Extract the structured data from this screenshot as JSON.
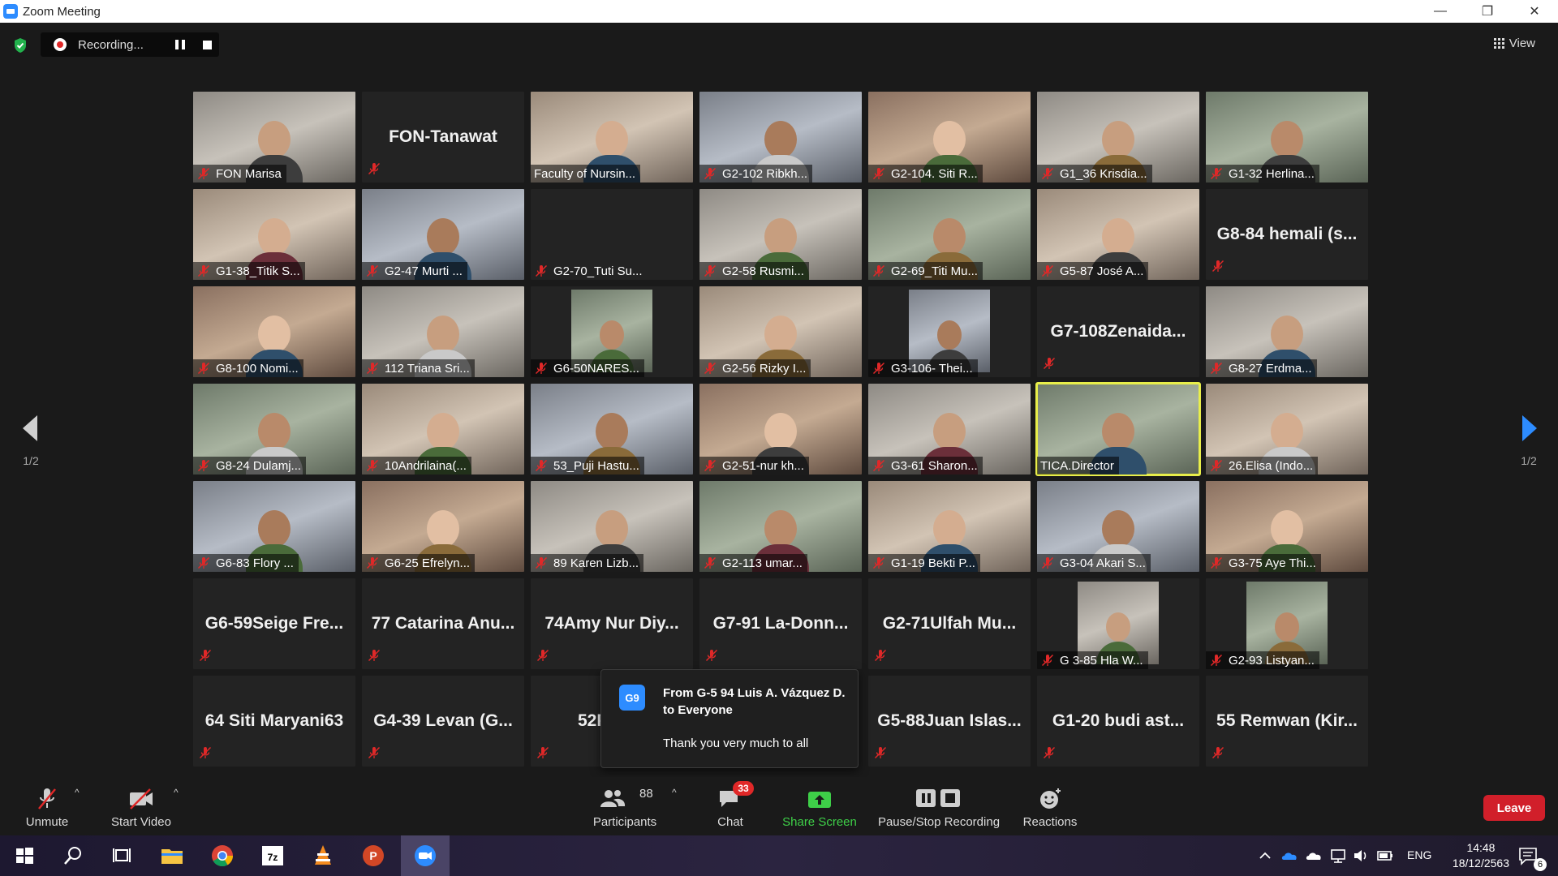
{
  "window": {
    "title": "Zoom Meeting",
    "controls": [
      "—",
      "❐",
      "✕"
    ]
  },
  "recording": {
    "status_text": "Recording...",
    "pause_label": "",
    "stop_label": ""
  },
  "view_button": {
    "label": "View"
  },
  "pagination": {
    "left": "1/2",
    "right": "1/2"
  },
  "participants": [
    {
      "name": "FON Marisa",
      "video": true,
      "muted": true
    },
    {
      "name": "FON-Tanawat",
      "video": false,
      "muted": true
    },
    {
      "name": "Faculty of Nursin...",
      "video": true,
      "muted": false
    },
    {
      "name": "G2-102 Ribkh...",
      "video": true,
      "muted": true
    },
    {
      "name": "G2-104. Siti R...",
      "video": true,
      "muted": true
    },
    {
      "name": "G1_36 Krisdia...",
      "video": true,
      "muted": true
    },
    {
      "name": "G1-32 Herlina...",
      "video": true,
      "muted": true
    },
    {
      "name": "G1-38_Titik S...",
      "video": true,
      "muted": true
    },
    {
      "name": "G2-47 Murti ...",
      "video": true,
      "muted": true
    },
    {
      "name": "G2-70_Tuti Su...",
      "video": true,
      "muted": true,
      "dark": true
    },
    {
      "name": "G2-58 Rusmi...",
      "video": true,
      "muted": true
    },
    {
      "name": "G2-69_Titi Mu...",
      "video": true,
      "muted": true
    },
    {
      "name": "G5-87 José A...",
      "video": true,
      "muted": true
    },
    {
      "name": "G8-84 hemali (s...",
      "video": false,
      "muted": true
    },
    {
      "name": "G8-100 Nomi...",
      "video": true,
      "muted": true
    },
    {
      "name": "112 Triana Sri...",
      "video": true,
      "muted": true
    },
    {
      "name": "G6-50NARES...",
      "video": true,
      "muted": true,
      "thumb": true
    },
    {
      "name": "G2-56 Rizky I...",
      "video": true,
      "muted": true
    },
    {
      "name": "G3-106- Thei...",
      "video": true,
      "muted": true,
      "thumb": true
    },
    {
      "name": "G7-108Zenaida...",
      "video": false,
      "muted": true
    },
    {
      "name": "G8-27 Erdma...",
      "video": true,
      "muted": true
    },
    {
      "name": "G8-24 Dulamj...",
      "video": true,
      "muted": true
    },
    {
      "name": "10Andrilaina(...",
      "video": true,
      "muted": true
    },
    {
      "name": "53_Puji Hastu...",
      "video": true,
      "muted": true
    },
    {
      "name": "G2-51-nur kh...",
      "video": true,
      "muted": true
    },
    {
      "name": "G3-61 Sharon...",
      "video": true,
      "muted": true
    },
    {
      "name": "TICA.Director",
      "video": true,
      "muted": false,
      "active": true
    },
    {
      "name": "26.Elisa (Indo...",
      "video": true,
      "muted": true
    },
    {
      "name": "G6-83 Flory ...",
      "video": true,
      "muted": true
    },
    {
      "name": "G6-25 Efrelyn...",
      "video": true,
      "muted": true
    },
    {
      "name": "89 Karen Lizb...",
      "video": true,
      "muted": true
    },
    {
      "name": "G2-113 umar...",
      "video": true,
      "muted": true
    },
    {
      "name": "G1-19 Bekti P...",
      "video": true,
      "muted": true
    },
    {
      "name": "G3-04 Akari S...",
      "video": true,
      "muted": true
    },
    {
      "name": "G3-75 Aye Thi...",
      "video": true,
      "muted": true
    },
    {
      "name": "G6-59Seige Fre...",
      "video": false,
      "muted": true
    },
    {
      "name": "77 Catarina Anu...",
      "video": false,
      "muted": true
    },
    {
      "name": "74Amy Nur Diy...",
      "video": false,
      "muted": true
    },
    {
      "name": "G7-91 La-Donn...",
      "video": false,
      "muted": true
    },
    {
      "name": "G2-71Ulfah Mu...",
      "video": false,
      "muted": true
    },
    {
      "name": "G 3-85 Hla W...",
      "video": true,
      "muted": true,
      "thumb": true
    },
    {
      "name": "G2-93 Listyan...",
      "video": true,
      "muted": true,
      "thumb": true
    },
    {
      "name": "64 Siti Maryani63",
      "video": false,
      "muted": true
    },
    {
      "name": "G4-39 Levan (G...",
      "video": false,
      "muted": true
    },
    {
      "name": "52Pornn",
      "video": false,
      "muted": true
    },
    {
      "name": "",
      "video": false,
      "muted": false,
      "hidden": true
    },
    {
      "name": "G5-88Juan Islas...",
      "video": false,
      "muted": true
    },
    {
      "name": "G1-20 budi ast...",
      "video": false,
      "muted": true
    },
    {
      "name": "55 Remwan (Kir...",
      "video": false,
      "muted": true
    }
  ],
  "chat_popup": {
    "avatar": "G9",
    "from": "From G-5 94 Luis A. Vázquez D. to Everyone",
    "message": "Thank you very much to all"
  },
  "toolbar": {
    "unmute": "Unmute",
    "start_video": "Start Video",
    "participants": "Participants",
    "participants_count": "88",
    "chat": "Chat",
    "chat_badge": "33",
    "share_screen": "Share Screen",
    "pause_stop": "Pause/Stop Recording",
    "reactions": "Reactions",
    "leave": "Leave"
  },
  "taskbar": {
    "language": "ENG",
    "time": "14:48",
    "date": "18/12/2563",
    "notifications": "6"
  },
  "colors": {
    "background": "#1a1a1a",
    "accent": "#2d8cff",
    "active_speaker": "#e8ee4a",
    "share_green": "#3ecf48",
    "leave_red": "#d11f2a",
    "mute_red": "#e02828"
  }
}
